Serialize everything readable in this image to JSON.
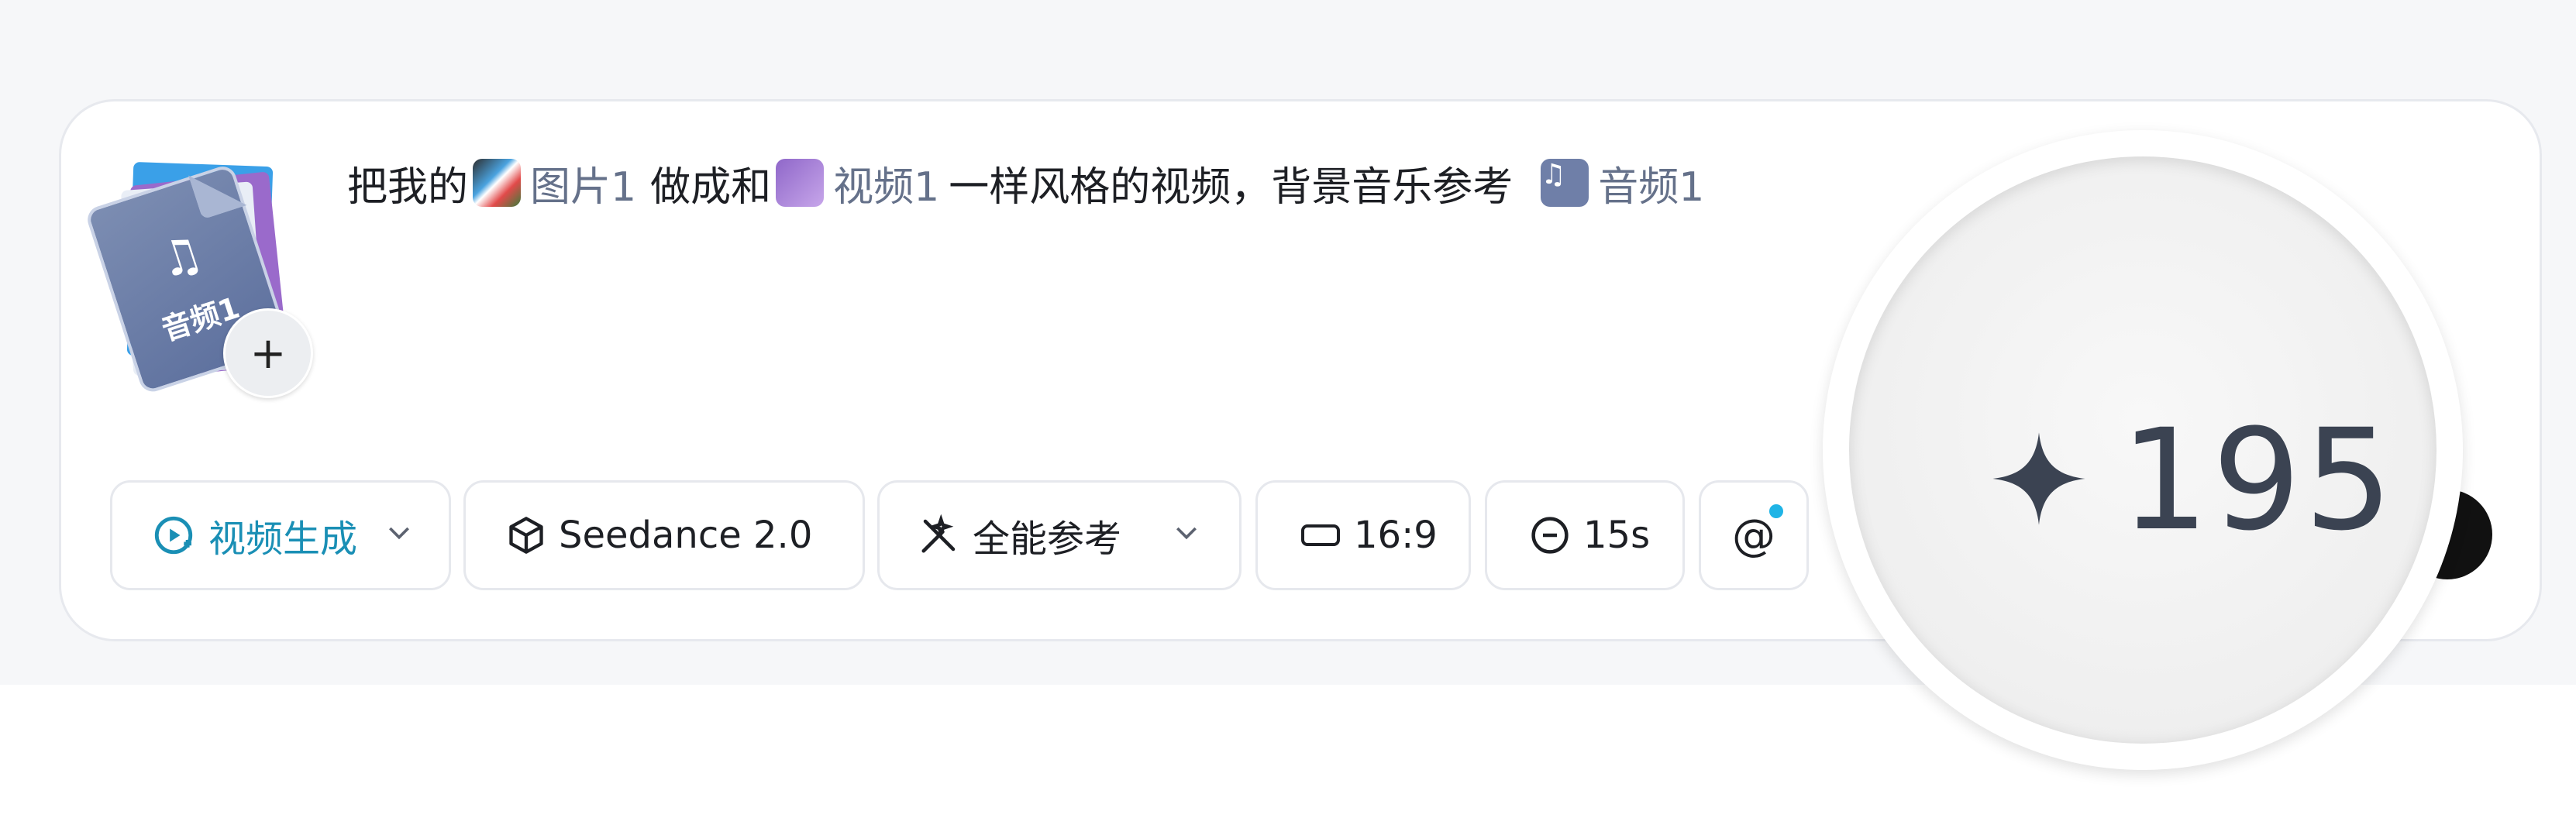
{
  "prompt": {
    "text_1": "把我的",
    "image_ref": "图片1",
    "text_2": "做成和",
    "video_ref": "视频1",
    "text_3": "一样风格的视频，背景音乐参考",
    "audio_ref": "音频1"
  },
  "attachment": {
    "label": "音频1",
    "add_symbol": "+"
  },
  "toolbar": {
    "mode_label": "视频生成",
    "model_label": "Seedance 2.0",
    "reference_label": "全能参考",
    "ratio_label": "16:9",
    "duration_label": "15s",
    "mention_label": "@"
  },
  "credits": {
    "value": "195"
  },
  "colors": {
    "accent": "#1a8fb5",
    "notify_dot": "#1fb4e6"
  }
}
